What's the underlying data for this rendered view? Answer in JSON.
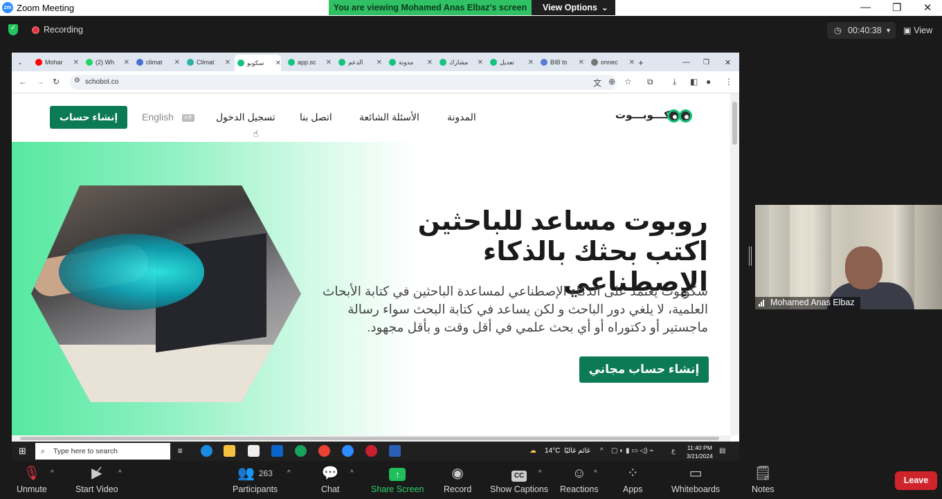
{
  "window": {
    "title": "Zoom Meeting",
    "logo_text": "zm"
  },
  "share_banner": {
    "message": "You are viewing Mohamed Anas Elbaz's screen",
    "options_label": "View Options"
  },
  "status": {
    "recording_label": "Recording",
    "timer": "00:40:38",
    "view_label": "View"
  },
  "browser": {
    "tabs": [
      {
        "label": "Mohar",
        "color": "#ff0000"
      },
      {
        "label": "(2) Wh",
        "color": "#25d366"
      },
      {
        "label": "climat",
        "color": "#4a6fd1"
      },
      {
        "label": "Climat",
        "color": "#2bb3a3"
      },
      {
        "label": "سكوبو",
        "color": "#15c37d"
      },
      {
        "label": "app.sc",
        "color": "#15c37d"
      },
      {
        "label": "الدعم",
        "color": "#15c37d"
      },
      {
        "label": "مدونة",
        "color": "#15c37d"
      },
      {
        "label": "مشارك",
        "color": "#15c37d"
      },
      {
        "label": "تعديل",
        "color": "#15c37d"
      },
      {
        "label": "BIB to",
        "color": "#5b7bd5"
      },
      {
        "label": "onnec",
        "color": "#777777"
      }
    ],
    "active_tab_index": 4,
    "url": "schobot.co"
  },
  "site": {
    "logo_text": "سكـــوبـــوت",
    "nav": {
      "signup": "إنشاء حساب",
      "language": "English",
      "login": "تسجيل الدخول",
      "contact": "اتصل بنا",
      "faq": "الأسئلة الشائعة",
      "blog": "المدونة"
    },
    "hero": {
      "title_line1": "روبوت مساعد للباحثين",
      "title_line2": "اكتب بحثك بالذكاء الإصطناعي",
      "description": "سكوبوت يعتمد على الذكاء الإصطناعي لمساعدة الباحثين في كتابة الأبحاث العلمية، لا يلغي دور الباحث و لكن يساعد في كتابة البحث سواء رسالة ماجستير أو دكتوراه أو أي بحث علمي في أقل وقت و بأقل مجهود.",
      "cta": "إنشاء حساب مجاني"
    }
  },
  "taskbar": {
    "search_placeholder": "Type here to search",
    "weather": "14°C",
    "weather_desc": "غائم غالبًا",
    "time": "11:40 PM",
    "date": "3/21/2024",
    "lang": "ع"
  },
  "participant": {
    "name": "Mohamed Anas Elbaz"
  },
  "toolbar": {
    "unmute": "Unmute",
    "start_video": "Start Video",
    "participants": "Participants",
    "participants_count": "263",
    "chat": "Chat",
    "share_screen": "Share Screen",
    "record": "Record",
    "captions": "Show Captions",
    "captions_icon_text": "CC",
    "reactions": "Reactions",
    "apps": "Apps",
    "whiteboards": "Whiteboards",
    "notes": "Notes",
    "leave": "Leave"
  },
  "colors": {
    "banner_green": "#2fc163",
    "brand_green": "#0b7a55",
    "leave_red": "#d0242c",
    "share_green": "#1fbf5c"
  }
}
